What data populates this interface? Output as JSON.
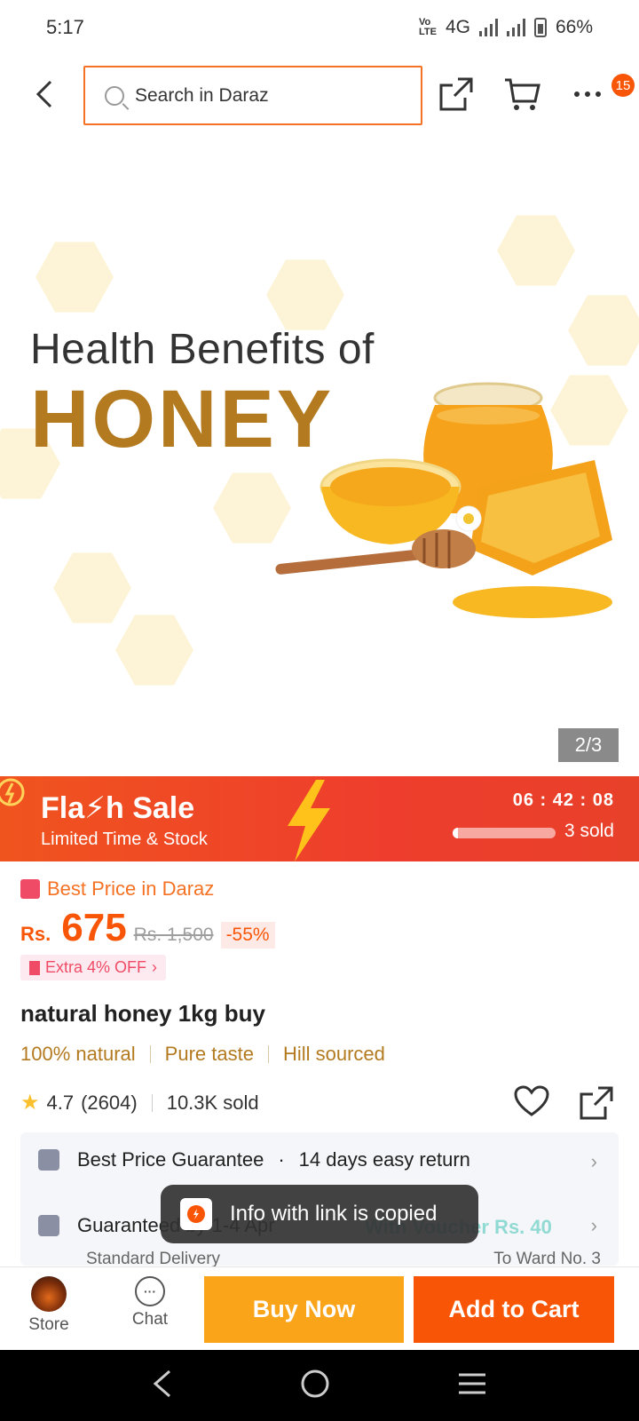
{
  "status_bar": {
    "time": "5:17",
    "network": "4G",
    "volte": "VoLTE2",
    "battery": "66%"
  },
  "header": {
    "search_placeholder": "Search in Daraz",
    "cart_badge": "15"
  },
  "hero": {
    "subtitle": "Health Benefits of",
    "title": "HONEY",
    "pager": "2/3"
  },
  "flash_sale": {
    "title": "Fla⚡h Sale",
    "subtitle": "Limited Time & Stock",
    "timer": "06 : 42 : 08",
    "sold": "3 sold",
    "sold_progress": 0.05
  },
  "product": {
    "best_price_label": "Best Price in Daraz",
    "currency": "Rs.",
    "price": "675",
    "old_price": "Rs. 1,500",
    "discount": "-55%",
    "extra_off": "Extra 4% OFF",
    "title": "natural honey 1kg buy",
    "tags": [
      "100% natural",
      "Pure taste",
      "Hill sourced"
    ],
    "rating": "4.7",
    "reviews": "(2604)",
    "sold": "10.3K sold"
  },
  "guarantee": {
    "row1_a": "Best Price Guarantee",
    "row1_b": "14 days easy return",
    "row2_a": "Guaranteed by 1-4 Apr",
    "row2_voucher": "With Voucher Rs. 40",
    "delivery_type": "Standard Delivery",
    "destination": "To Ward No. 3"
  },
  "toast": {
    "message": "Info with link is copied"
  },
  "bottom_bar": {
    "store_label": "Store",
    "chat_label": "Chat",
    "buy_now": "Buy Now",
    "add_to_cart": "Add to Cart"
  },
  "colors": {
    "brand": "#f85606",
    "buy_now": "#faa41a",
    "flash_bg": "#ee3d2d",
    "tag": "#b37a1f",
    "voucher": "#1ab9a7"
  }
}
